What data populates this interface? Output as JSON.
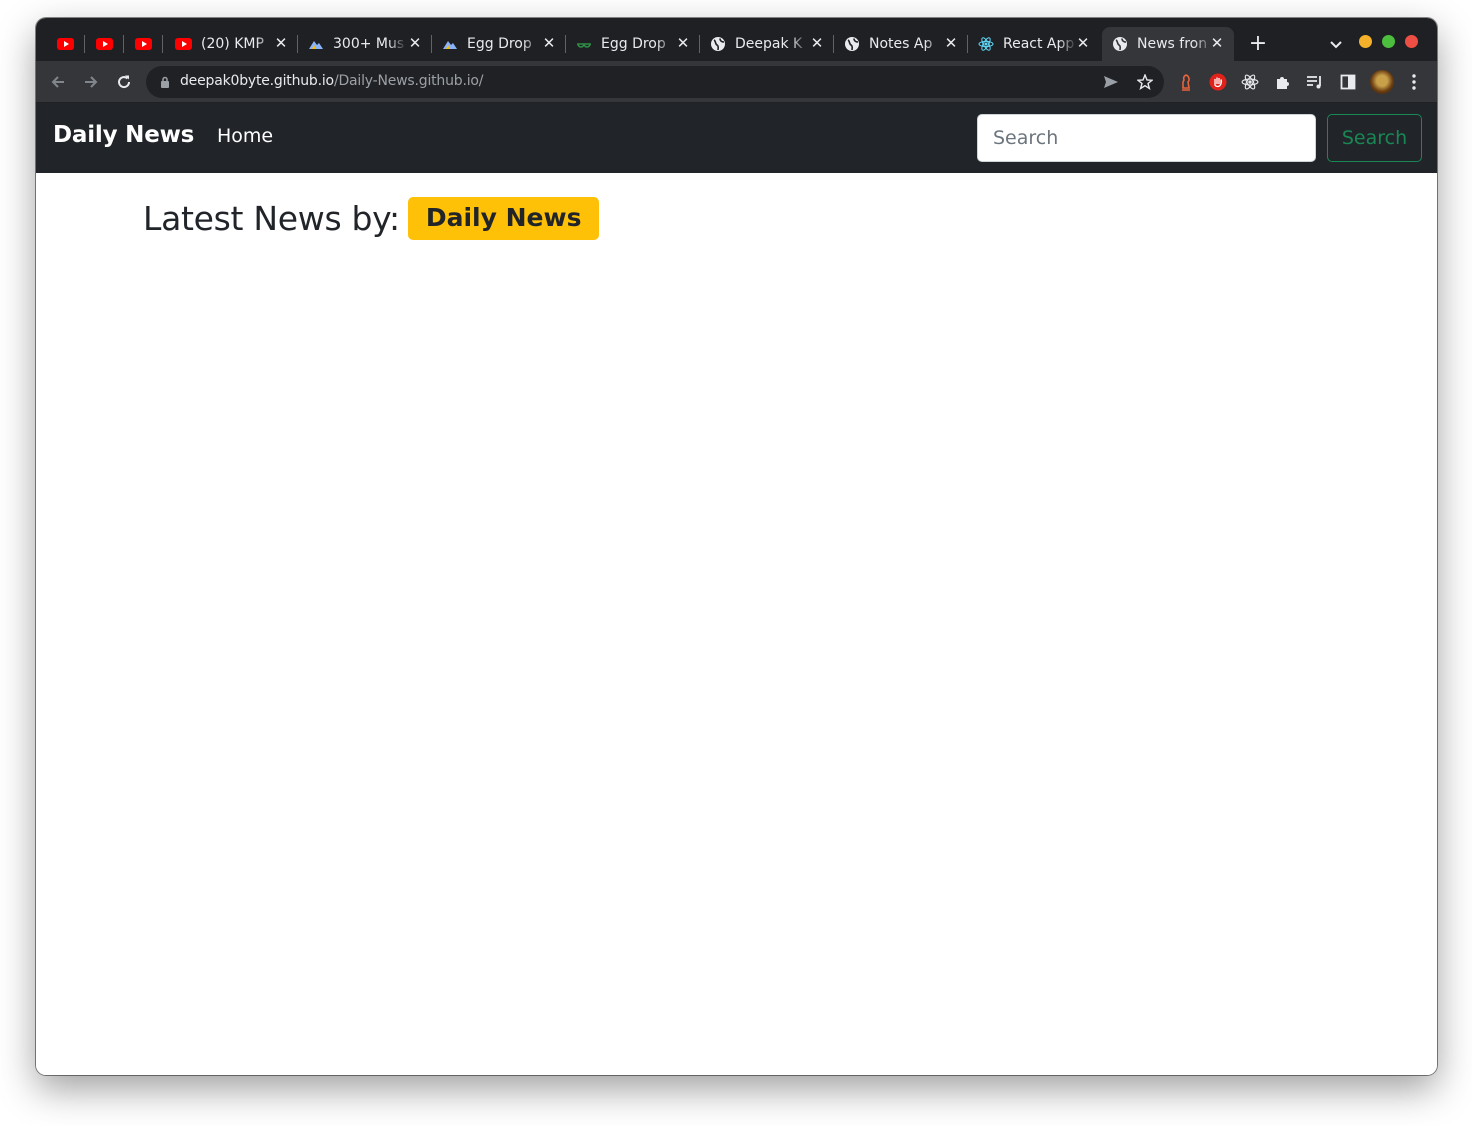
{
  "browser": {
    "tabs": [
      {
        "kind": "pinned",
        "icon": "youtube-icon",
        "title": ""
      },
      {
        "kind": "pinned",
        "icon": "youtube-icon",
        "title": ""
      },
      {
        "kind": "pinned",
        "icon": "youtube-icon",
        "title": ""
      },
      {
        "kind": "tab",
        "icon": "youtube-icon",
        "title": "(20) KMP"
      },
      {
        "kind": "tab",
        "icon": "mountain-icon",
        "title": "300+ Mus"
      },
      {
        "kind": "tab",
        "icon": "mountain-icon",
        "title": "Egg Drop"
      },
      {
        "kind": "tab",
        "icon": "gfg-icon",
        "title": "Egg Drop"
      },
      {
        "kind": "tab",
        "icon": "globe-icon",
        "title": "Deepak K"
      },
      {
        "kind": "tab",
        "icon": "globe-icon",
        "title": "Notes Ap"
      },
      {
        "kind": "tab",
        "icon": "react-icon",
        "title": "React App"
      },
      {
        "kind": "tab",
        "icon": "globe-icon",
        "title": "News fron",
        "active": true
      }
    ],
    "url_host": "deepak0byte.github.io",
    "url_path": "/Daily-News.github.io/"
  },
  "navbar": {
    "brand": "Daily News",
    "home_link": "Home",
    "search_placeholder": "Search",
    "search_button": "Search"
  },
  "main": {
    "heading": "Latest News by:",
    "badge": "Daily News"
  },
  "colors": {
    "navbar_bg": "#212529",
    "badge_bg": "#ffc107",
    "search_button": "#198754",
    "tab_strip": "#1f2023",
    "toolbar": "#35363a"
  }
}
